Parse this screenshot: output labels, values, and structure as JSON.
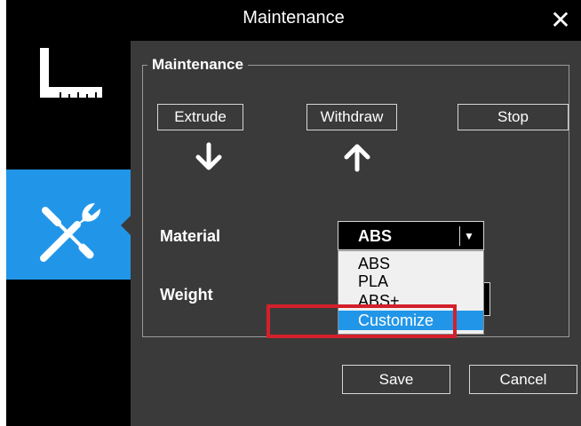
{
  "window": {
    "title": "Maintenance"
  },
  "icons": {
    "close": "close-icon",
    "measure": "ruler-icon",
    "tools": "wrench-screwdriver-icon",
    "down": "arrow-down-icon",
    "up": "arrow-up-icon",
    "dropdown": "chevron-down-icon"
  },
  "colors": {
    "sidebar_active": "#2196e8",
    "highlight": "#d3202b",
    "panel_bg": "#3a3a3a"
  },
  "section": {
    "legend": "Maintenance"
  },
  "buttons": {
    "extrude": "Extrude",
    "withdraw": "Withdraw",
    "stop": "Stop"
  },
  "material": {
    "label": "Material",
    "selected": "ABS",
    "options": [
      "ABS",
      "PLA",
      "ABS+",
      "Customize"
    ],
    "highlighted_option": "Customize"
  },
  "weight": {
    "label": "Weight"
  },
  "footer": {
    "save": "Save",
    "cancel": "Cancel"
  }
}
